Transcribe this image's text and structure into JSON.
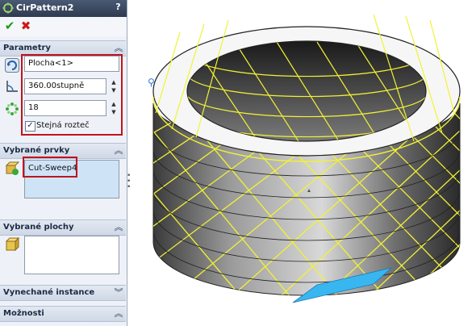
{
  "panel": {
    "title": "CirPattern2",
    "help": "?",
    "sections": {
      "parameters": {
        "label": "Parametry",
        "collapse_icon": "chevron-up-icon"
      },
      "features": {
        "label": "Vybrané prvky",
        "collapse_icon": "chevron-up-icon"
      },
      "faces": {
        "label": "Vybrané plochy",
        "collapse_icon": "chevron-up-icon"
      },
      "skipped": {
        "label": "Vynechané instance",
        "collapse_icon": "chevron-down-icon"
      },
      "options": {
        "label": "Možnosti",
        "collapse_icon": "chevron-up-icon"
      }
    },
    "params": {
      "axis": "Plocha<1>",
      "angle": "360.00stupně",
      "count": "18",
      "equal_spacing_label": "Stejná rozteč",
      "equal_spacing_checked": true
    },
    "features_list": [
      "Cut-Sweep4"
    ],
    "faces_list": []
  },
  "colors": {
    "highlight_red": "#c0141e",
    "knurl_yellow": "#f2f233",
    "selection_blue": "#38b6f0",
    "title_bar": "#3a4860"
  }
}
